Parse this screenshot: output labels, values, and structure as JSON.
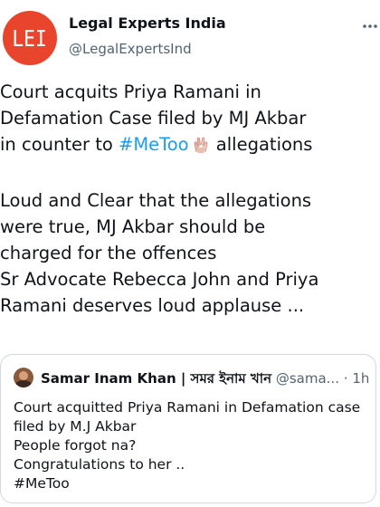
{
  "author": {
    "avatar_text": "LEI",
    "name": "Legal Experts India",
    "handle": "@LegalExpertsInd"
  },
  "icons": {
    "more": "more-horizontal-icon",
    "emoji": "raised-hands-emoji"
  },
  "tweet": {
    "line1": "Court acquits Priya Ramani in",
    "line2": "Defamation Case filed by MJ Akbar",
    "line3_pre": "in counter to ",
    "hashtag": "#MeToo",
    "line3_post": " allegations",
    "line4": "Loud and Clear that the allegations",
    "line5": "were true, MJ Akbar should be",
    "line6": "charged for the offences",
    "line7": "Sr Advocate Rebecca John and Priya",
    "line8": "Ramani deserves loud applause ..."
  },
  "quoted_tweet": {
    "name": "Samar Inam Khan | সমর ইনাম খান",
    "handle": "@sama...",
    "separator": "·",
    "time": "1h",
    "lines": [
      "Court acquitted Priya Ramani in Defamation case",
      "filed by M.J Akbar",
      "People forgot na?",
      "Congratulations to her ..",
      "#MeToo"
    ]
  },
  "colors": {
    "avatar_bg": "#e8452c",
    "link": "#1d9bf0",
    "secondary_text": "#536471",
    "border": "#cfd9de"
  }
}
